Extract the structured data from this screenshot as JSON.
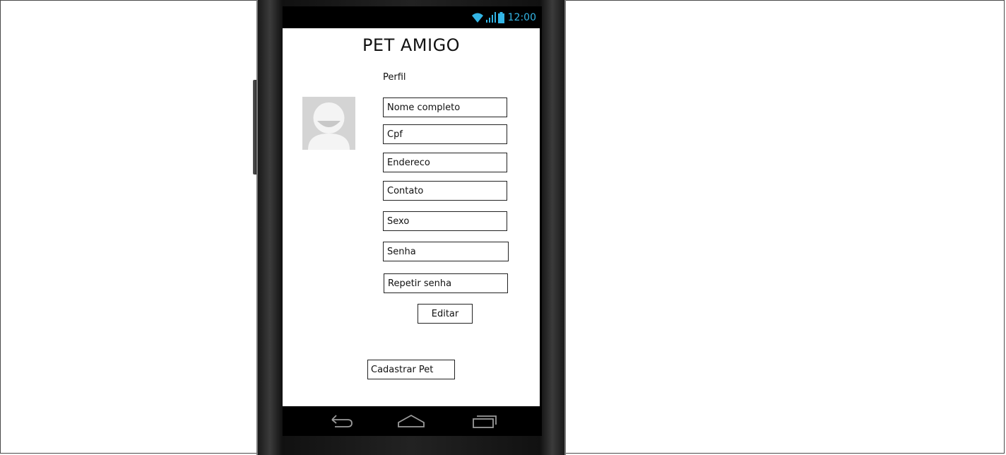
{
  "status_bar": {
    "time": "12:00"
  },
  "app": {
    "title": "PET AMIGO"
  },
  "profile": {
    "section_label": "Perfil",
    "fields": [
      {
        "label": "Nome completo"
      },
      {
        "label": "Cpf"
      },
      {
        "label": "Endereco"
      },
      {
        "label": "Contato"
      },
      {
        "label": "Sexo"
      },
      {
        "label": "Senha"
      },
      {
        "label": "Repetir senha"
      }
    ],
    "edit_label": "Editar"
  },
  "actions": {
    "register_pet_label": "Cadastrar Pet"
  },
  "colors": {
    "status_accent": "#33b5e5",
    "avatar_bg": "#d4d4d4"
  }
}
